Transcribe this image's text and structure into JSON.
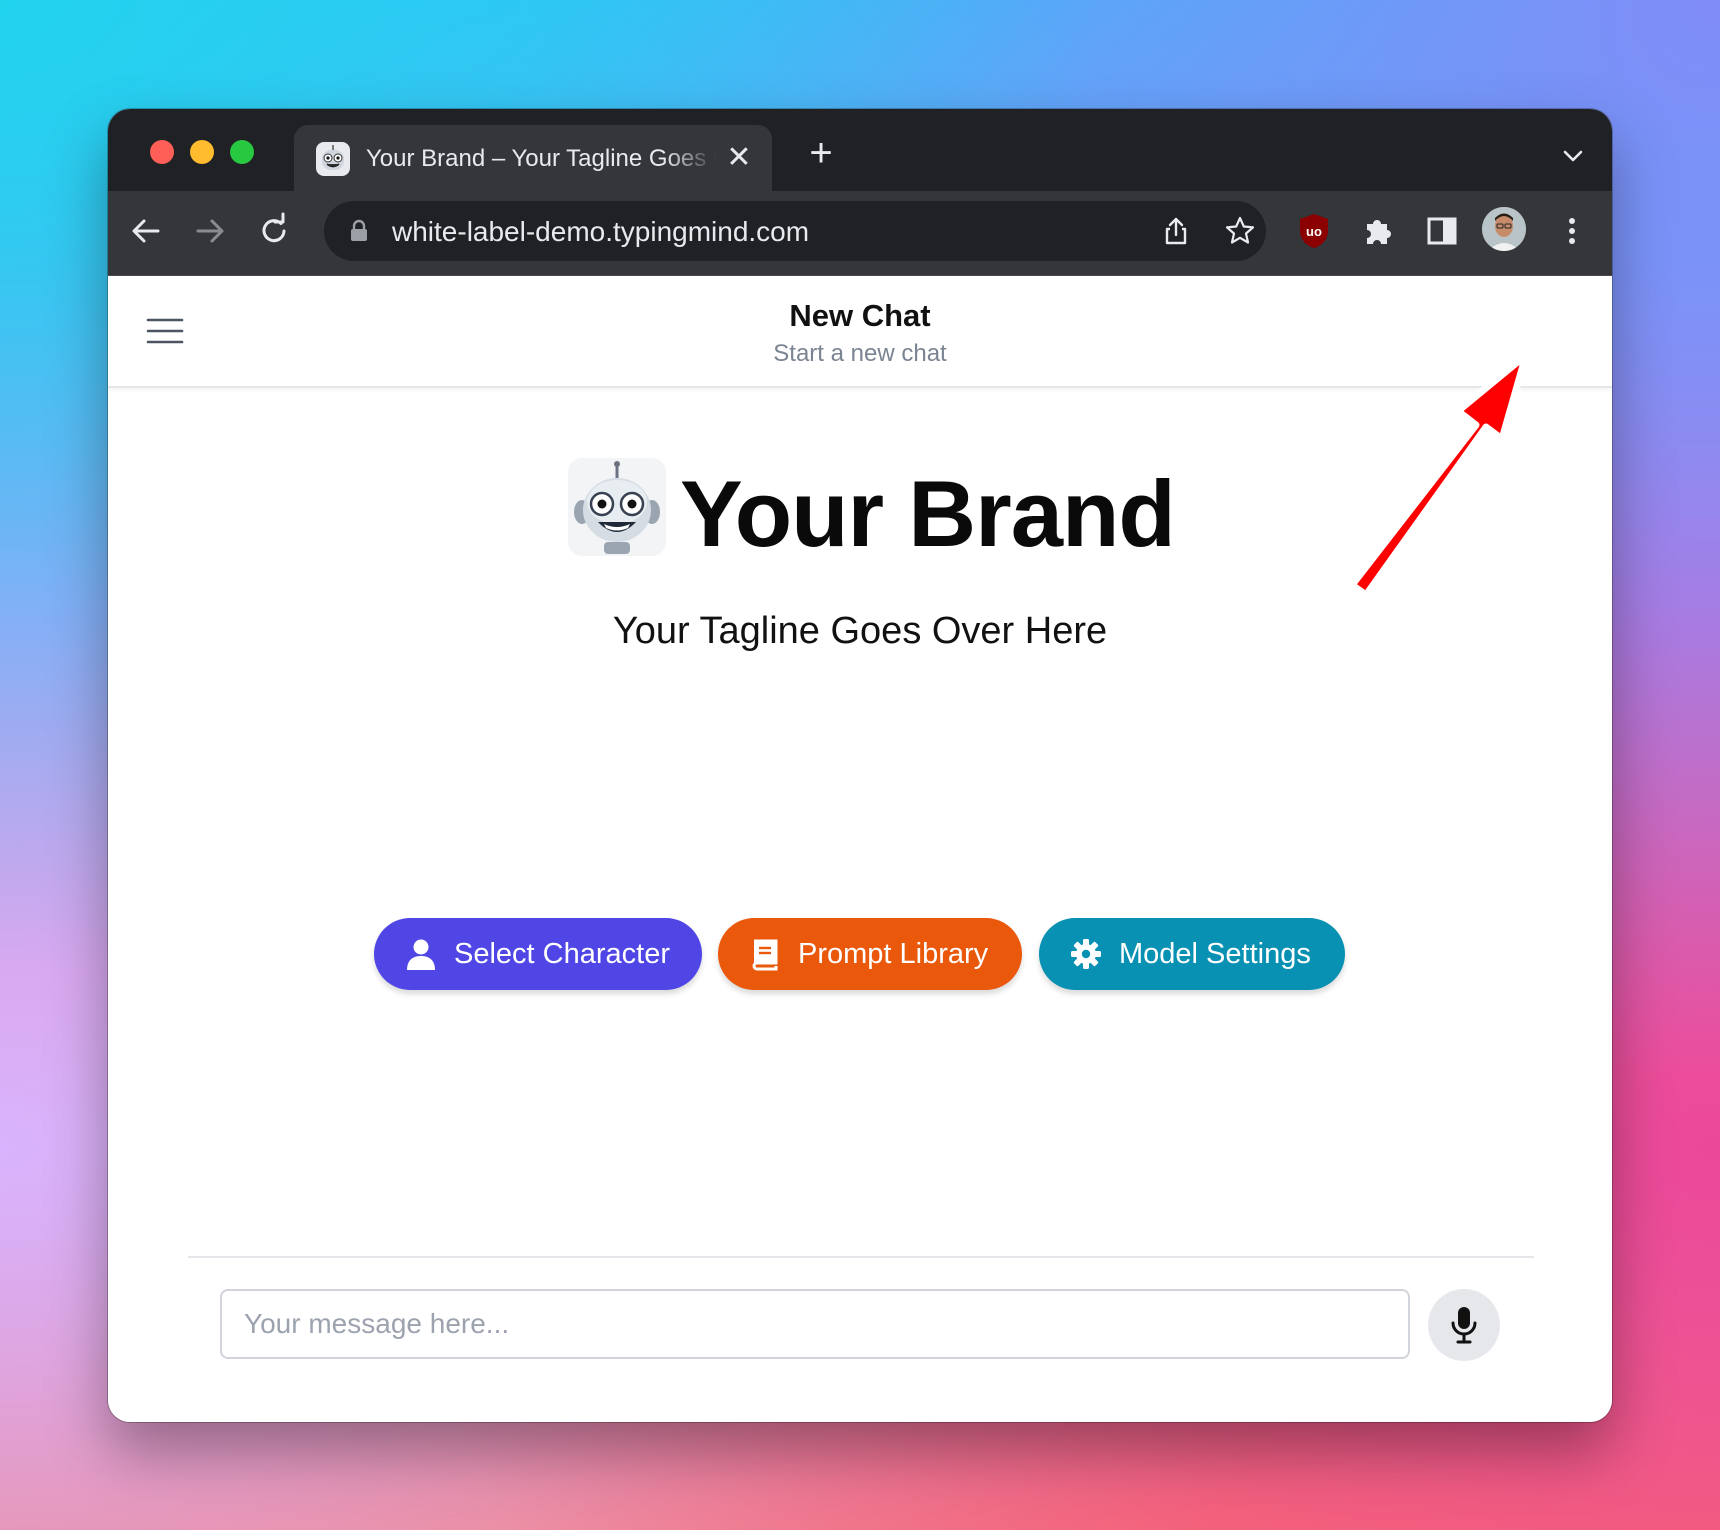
{
  "browser": {
    "tab": {
      "title": "Your Brand – Your Tagline Goes Over Here",
      "close_glyph": "✕"
    },
    "new_tab_glyph": "+",
    "url": "white-label-demo.typingmind.com",
    "icons": [
      "back-icon",
      "forward-icon",
      "reload-icon",
      "lock-icon",
      "share-icon",
      "bookmark-star-icon",
      "ublock-icon",
      "extensions-icon",
      "side-panel-icon",
      "profile-avatar",
      "kebab-menu-icon",
      "tab-dropdown-icon"
    ]
  },
  "app": {
    "header": {
      "title": "New Chat",
      "subtitle": "Start a new chat"
    },
    "brand": {
      "name": "Your Brand",
      "tagline": "Your Tagline Goes Over Here"
    },
    "actions": {
      "select_character": "Select Character",
      "prompt_library": "Prompt Library",
      "model_settings": "Model Settings"
    },
    "composer": {
      "placeholder": "Your message here..."
    }
  },
  "colors": {
    "select_character": "#4f46e5",
    "prompt_library": "#ea580c",
    "model_settings": "#0891b2",
    "annotation_arrow": "#ff0000"
  }
}
